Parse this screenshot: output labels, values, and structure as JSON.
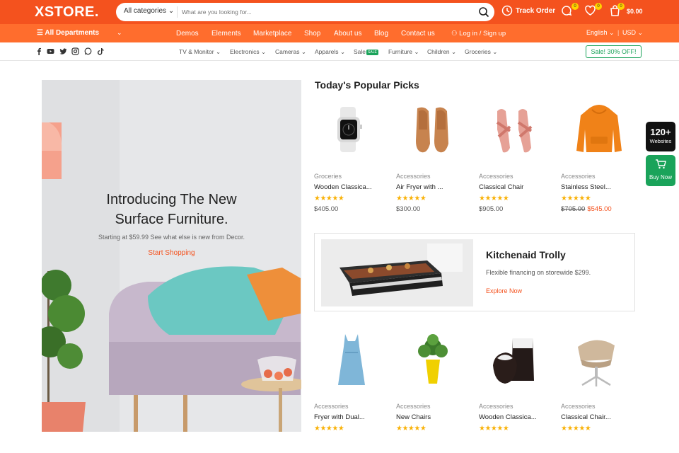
{
  "header": {
    "logo": "XSTORE.",
    "category_select": "All categories",
    "search_placeholder": "What are you looking for...",
    "track_order": "Track Order",
    "compare_count": "0",
    "wishlist_count": "0",
    "cart_count": "0",
    "cart_total": "$0.00",
    "accent": "#f4521e"
  },
  "navbar": {
    "departments": "All Departments",
    "links": [
      "Demos",
      "Elements",
      "Marketplace",
      "Shop",
      "About us",
      "Blog",
      "Contact us"
    ],
    "login": "Log in / Sign up",
    "language": "English",
    "currency": "USD"
  },
  "category_bar": {
    "social": [
      "facebook-icon",
      "youtube-icon",
      "twitter-icon",
      "instagram-icon",
      "whatsapp-icon",
      "tiktok-icon"
    ],
    "items": [
      "TV & Monitor",
      "Electronics",
      "Cameras",
      "Apparels",
      "Sale",
      "Furniture",
      "Children",
      "Groceries"
    ],
    "sale_badge": "SALE",
    "sale_button": "Sale! 30% OFF!"
  },
  "hero": {
    "title_line1": "Introducing The New",
    "title_line2": "Surface Furniture.",
    "subtitle": "Starting at $59.99 See what else is new from Decor.",
    "cta": "Start Shopping"
  },
  "popular": {
    "title": "Today's Popular Picks",
    "row1": [
      {
        "category": "Groceries",
        "name": "Wooden Classica...",
        "stars": "★★★★★",
        "price": "$405.00"
      },
      {
        "category": "Accessories",
        "name": "Air Fryer with ...",
        "stars": "★★★★★",
        "price": "$300.00"
      },
      {
        "category": "Accessories",
        "name": "Classical Chair",
        "stars": "★★★★★",
        "price": "$905.00"
      },
      {
        "category": "Accessories",
        "name": "Stainless Steel...",
        "stars": "★★★★★",
        "old_price": "$705.00",
        "price": "$545.00"
      }
    ],
    "row2": [
      {
        "category": "Accessories",
        "name": "Fryer with Dual...",
        "stars": "★★★★★"
      },
      {
        "category": "Accessories",
        "name": "New Chairs",
        "stars": "★★★★★"
      },
      {
        "category": "Accessories",
        "name": "Wooden Classica...",
        "stars": "★★★★★"
      },
      {
        "category": "Accessories",
        "name": "Classical Chair...",
        "stars": "★★★★★"
      }
    ]
  },
  "promo": {
    "title": "Kitchenaid Trolly",
    "description": "Flexible financing on storewide $299.",
    "link": "Explore Now"
  },
  "side": {
    "count": "120+",
    "count_label": "Websites",
    "buy": "Buy Now"
  }
}
